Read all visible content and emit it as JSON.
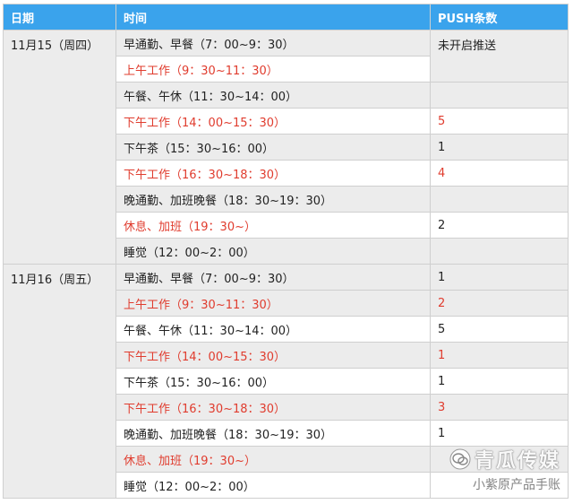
{
  "headers": {
    "date": "日期",
    "time": "时间",
    "push": "PUSH条数"
  },
  "day1": {
    "date": "11月15（周四）",
    "rows": [
      {
        "time": "早通勤、早餐（7：00~9：30）",
        "push": "未开启推送"
      },
      {
        "time": "上午工作（9：30~11：30）",
        "push": ""
      },
      {
        "time": "午餐、午休（11：30~14：00）",
        "push": ""
      },
      {
        "time": "下午工作（14：00~15：30）",
        "push": "5"
      },
      {
        "time": "下午茶（15：30~16：00）",
        "push": "1"
      },
      {
        "time": "下午工作（16：30~18：30）",
        "push": "4"
      },
      {
        "time": "晚通勤、加班晚餐（18：30~19：30）",
        "push": ""
      },
      {
        "time": "休息、加班（19：30~）",
        "push": "2"
      },
      {
        "time": "睡觉（12：00~2：00）",
        "push": ""
      }
    ]
  },
  "day2": {
    "date": "11月16（周五）",
    "rows": [
      {
        "time": "早通勤、早餐（7：00~9：30）",
        "push": "1"
      },
      {
        "time": "上午工作（9：30~11：30）",
        "push": "2"
      },
      {
        "time": "午餐、午休（11：30~14：00）",
        "push": "5"
      },
      {
        "time": "下午工作（14：00~15：30）",
        "push": "1"
      },
      {
        "time": "下午茶（15：30~16：00）",
        "push": "1"
      },
      {
        "time": "下午工作（16：30~18：30）",
        "push": "3"
      },
      {
        "time": "晚通勤、加班晚餐（18：30~19：30）",
        "push": "1"
      },
      {
        "time": "休息、加班（19：30~）",
        "push": ""
      },
      {
        "time": "睡觉（12：00~2：00）",
        "push": ""
      }
    ]
  },
  "watermark": {
    "brand": "青瓜传媒",
    "sub": "小紫原产品手账"
  },
  "colors": {
    "header_bg": "#3aa3ec",
    "highlight_text": "#e03c2e",
    "gray_row": "#ececec"
  }
}
